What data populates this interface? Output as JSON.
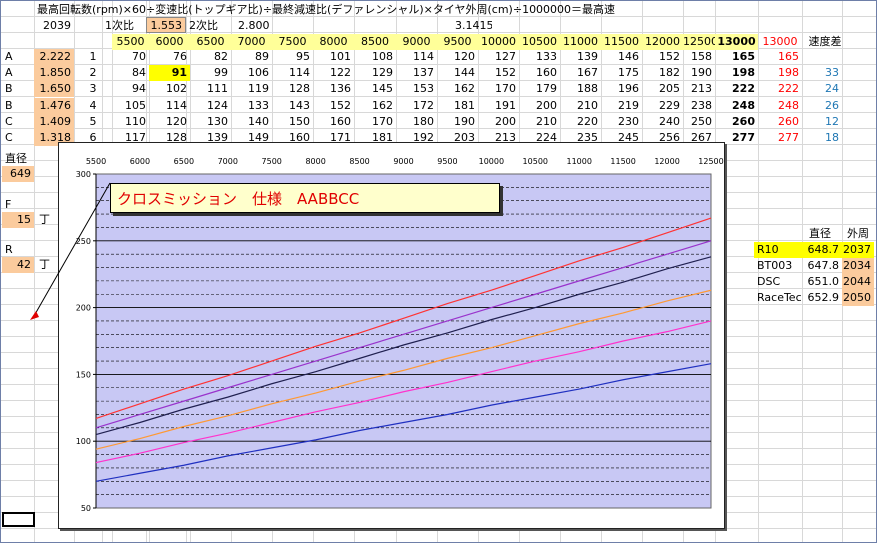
{
  "formula": "最高回転数(rpm)×60÷変速比(トップギア比)÷最終減速比(デファレンシャル)×タイヤ外周(cm)÷1000000＝最高速",
  "top_row": {
    "rpm_val": "2039",
    "label1": "1次比",
    "ratio1": "1.553",
    "label2": "2次比",
    "ratio2": "2.800",
    "pi": "3.1415"
  },
  "rpm_headers": [
    "5500",
    "6000",
    "6500",
    "7000",
    "7500",
    "8000",
    "8500",
    "9000",
    "9500",
    "10000",
    "10500",
    "11000",
    "11500",
    "12000",
    "12500",
    "13000"
  ],
  "ref_header": "13000",
  "speed_diff_header": "速度差",
  "gears": [
    {
      "code": "A",
      "ratio": "2.222",
      "num": "1",
      "vals": [
        "70",
        "76",
        "82",
        "89",
        "95",
        "101",
        "108",
        "114",
        "120",
        "127",
        "133",
        "139",
        "146",
        "152",
        "158",
        "165"
      ],
      "ref": "165",
      "diff": ""
    },
    {
      "code": "A",
      "ratio": "1.850",
      "num": "2",
      "vals": [
        "84",
        "91",
        "99",
        "106",
        "114",
        "122",
        "129",
        "137",
        "144",
        "152",
        "160",
        "167",
        "175",
        "182",
        "190",
        "198"
      ],
      "ref": "198",
      "diff": "33"
    },
    {
      "code": "B",
      "ratio": "1.650",
      "num": "3",
      "vals": [
        "94",
        "102",
        "111",
        "119",
        "128",
        "136",
        "145",
        "153",
        "162",
        "170",
        "179",
        "188",
        "196",
        "205",
        "213",
        "222"
      ],
      "ref": "222",
      "diff": "24"
    },
    {
      "code": "B",
      "ratio": "1.476",
      "num": "4",
      "vals": [
        "105",
        "114",
        "124",
        "133",
        "143",
        "152",
        "162",
        "172",
        "181",
        "191",
        "200",
        "210",
        "219",
        "229",
        "238",
        "248"
      ],
      "ref": "248",
      "diff": "26"
    },
    {
      "code": "C",
      "ratio": "1.409",
      "num": "5",
      "vals": [
        "110",
        "120",
        "130",
        "140",
        "150",
        "160",
        "170",
        "180",
        "190",
        "200",
        "210",
        "220",
        "230",
        "240",
        "250",
        "260"
      ],
      "ref": "260",
      "diff": "12"
    },
    {
      "code": "C",
      "ratio": "1.318",
      "num": "6",
      "vals": [
        "117",
        "128",
        "139",
        "149",
        "160",
        "171",
        "181",
        "192",
        "203",
        "213",
        "224",
        "235",
        "245",
        "256",
        "267",
        "277"
      ],
      "ref": "277",
      "diff": "18"
    }
  ],
  "side": {
    "diameter_label": "直径",
    "diameter_val": "649",
    "f_label": "F",
    "f_val": "15",
    "f_unit": "丁",
    "r_label": "R",
    "r_val": "42",
    "r_unit": "丁"
  },
  "tires": {
    "h_diameter": "直径",
    "h_circ": "外周",
    "rows": [
      {
        "name": "R10",
        "dia": "648.7",
        "circ": "2037"
      },
      {
        "name": "BT003",
        "dia": "647.8",
        "circ": "2034"
      },
      {
        "name": "DSC",
        "dia": "651.0",
        "circ": "2044"
      },
      {
        "name": "RaceTec",
        "dia": "652.9",
        "circ": "2050"
      }
    ]
  },
  "chart_title": "クロスミッション　仕様　AABBCC",
  "chart_data": {
    "type": "line",
    "title": "クロスミッション　仕様　AABBCC",
    "x": [
      5500,
      6000,
      6500,
      7000,
      7500,
      8000,
      8500,
      9000,
      9500,
      10000,
      10500,
      11000,
      11500,
      12000,
      12500
    ],
    "xticks": [
      "5500",
      "6000",
      "6500",
      "7000",
      "7500",
      "8000",
      "8500",
      "9000",
      "9500",
      "10000",
      "10500",
      "11000",
      "11500",
      "12000",
      "12500"
    ],
    "yticks": [
      "300",
      "250",
      "200",
      "150",
      "100",
      "50"
    ],
    "xlim": [
      5500,
      12500
    ],
    "ylim": [
      50,
      300
    ],
    "grid": true,
    "series": [
      {
        "color": "#2030c0",
        "values": [
          70,
          76,
          82,
          89,
          95,
          101,
          108,
          114,
          120,
          127,
          133,
          139,
          146,
          152,
          158
        ]
      },
      {
        "color": "#ff33cc",
        "values": [
          84,
          91,
          99,
          106,
          114,
          122,
          129,
          137,
          144,
          152,
          160,
          167,
          175,
          182,
          190
        ]
      },
      {
        "color": "#ff9933",
        "values": [
          94,
          102,
          111,
          119,
          128,
          136,
          145,
          153,
          162,
          170,
          179,
          188,
          196,
          205,
          213
        ]
      },
      {
        "color": "#202050",
        "values": [
          105,
          114,
          124,
          133,
          143,
          152,
          162,
          172,
          181,
          191,
          200,
          210,
          219,
          229,
          238
        ]
      },
      {
        "color": "#9933cc",
        "values": [
          110,
          120,
          130,
          140,
          150,
          160,
          170,
          180,
          190,
          200,
          210,
          220,
          230,
          240,
          250
        ]
      },
      {
        "color": "#ff3333",
        "values": [
          117,
          128,
          139,
          149,
          160,
          171,
          181,
          192,
          203,
          213,
          224,
          235,
          245,
          256,
          267
        ]
      }
    ]
  }
}
